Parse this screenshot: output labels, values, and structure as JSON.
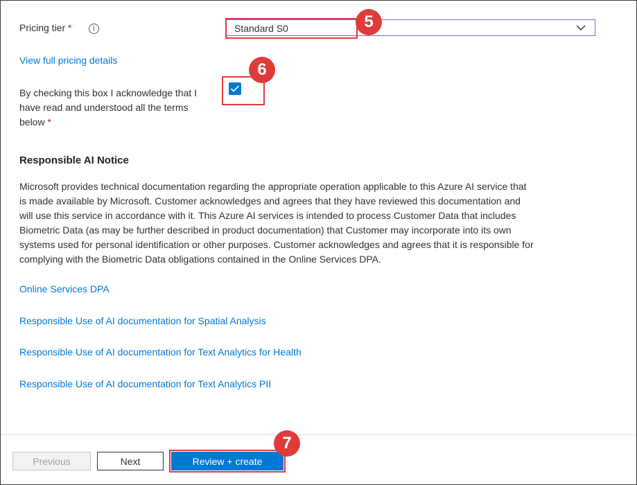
{
  "pricing": {
    "label": "Pricing tier",
    "required_mark": "*",
    "info_glyph": "i",
    "selected": "Standard S0",
    "view_details_link": "View full pricing details"
  },
  "acknowledge": {
    "line1": "By checking this box I acknowledge that I",
    "line2": "have read and understood all the terms",
    "line3": "below",
    "required_mark": "*",
    "checked": true
  },
  "notice": {
    "heading": "Responsible AI Notice",
    "lines": [
      "Microsoft provides technical documentation regarding the appropriate operation applicable to this Azure AI service that",
      "is made available by Microsoft. Customer acknowledges and agrees that they have reviewed this documentation and",
      "will use this service in accordance with it. This Azure AI services is intended to process Customer Data that includes",
      "Biometric Data (as may be further described in product documentation) that Customer may incorporate into its own",
      "systems used for personal identification or other purposes. Customer acknowledges and agrees that it is responsible for",
      "complying with the Biometric Data obligations contained in the Online Services DPA."
    ]
  },
  "links": {
    "dpa": "Online Services DPA",
    "spatial": "Responsible Use of AI documentation for Spatial Analysis",
    "health": "Responsible Use of AI documentation for Text Analytics for Health",
    "pii": "Responsible Use of AI documentation for Text Analytics PII"
  },
  "footer": {
    "previous": "Previous",
    "next": "Next",
    "review_create": "Review + create"
  },
  "callouts": {
    "step5": "5",
    "step6": "6",
    "step7": "7"
  },
  "colors": {
    "accent": "#0078d4",
    "callout": "#e03b3b",
    "required": "#a4262c"
  },
  "icons": {
    "info": "info-icon",
    "dropdown": "chevron-down-icon",
    "checkbox": "checkmark-icon"
  }
}
